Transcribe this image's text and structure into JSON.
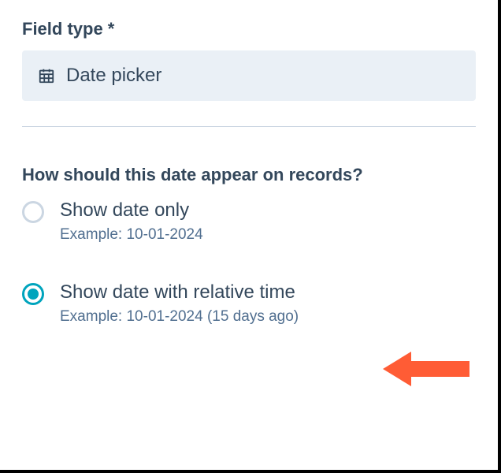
{
  "field": {
    "label": "Field type *",
    "selected_value": "Date picker"
  },
  "question": {
    "label": "How should this date appear on records?"
  },
  "options": [
    {
      "label": "Show date only",
      "example": "Example: 10-01-2024",
      "selected": false
    },
    {
      "label": "Show date with relative time",
      "example": "Example: 10-01-2024 (15 days ago)",
      "selected": true
    }
  ]
}
